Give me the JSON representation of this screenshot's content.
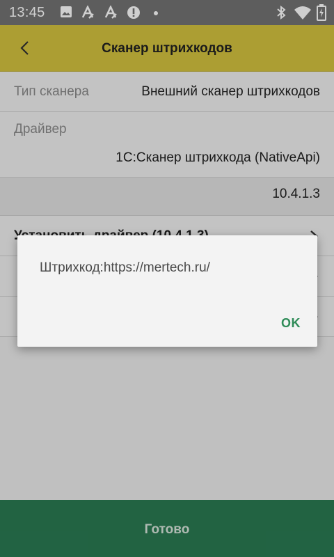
{
  "status_bar": {
    "time": "13:45",
    "icons_left": [
      "image-icon",
      "notification-a-icon",
      "notification-a-icon",
      "alert-icon",
      "dot-icon"
    ],
    "icons_right": [
      "bluetooth-icon",
      "wifi-icon",
      "battery-charging-icon"
    ]
  },
  "app_bar": {
    "title": "Сканер штрихкодов",
    "back_icon": "chevron-left-icon",
    "background": "#d4c33f"
  },
  "settings": {
    "scanner_type": {
      "label": "Тип сканера",
      "value": "Внешний сканер штрихкодов"
    },
    "driver": {
      "label": "Драйвер",
      "value": "1С:Сканер штрихкода (NativeApi)",
      "version": "10.4.1.3"
    },
    "link_install": {
      "label": "Установить драйвер (10.4.1.3)"
    }
  },
  "dialog": {
    "message": "Штрихкод:https://mertech.ru/",
    "ok_label": "OK",
    "ok_color": "#2e8b57"
  },
  "bottom_bar": {
    "done_label": "Готово",
    "background": "#2a7a52"
  }
}
